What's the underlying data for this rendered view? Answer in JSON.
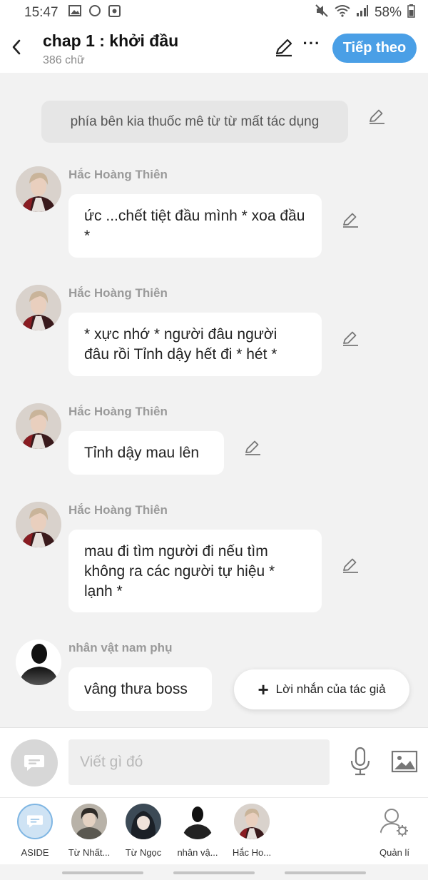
{
  "status_bar": {
    "time": "15:47",
    "battery": "58%"
  },
  "header": {
    "title": "chap 1 : khởi đầu",
    "subtitle": "386 chữ",
    "next_label": "Tiếp theo",
    "more": "···"
  },
  "narration": "phía bên kia thuốc mê từ từ mất tác dụng",
  "messages": [
    {
      "name": "Hắc Hoàng Thiên",
      "text": "ức ...chết tiệt đầu mình * xoa đầu *"
    },
    {
      "name": "Hắc Hoàng Thiên",
      "text": "* xực nhớ * người đâu người đâu rồi Tỉnh dậy hết đi * hét *"
    },
    {
      "name": "Hắc Hoàng Thiên",
      "text": "Tỉnh dậy mau lên"
    },
    {
      "name": "Hắc Hoàng Thiên",
      "text": "mau đi tìm người đi nếu tìm không ra các người tự hiệu * lạnh *"
    },
    {
      "name": "nhân vật nam phụ",
      "text": "vâng thưa boss"
    }
  ],
  "author_note": {
    "plus": "+",
    "label": "Lời nhắn của tác giả"
  },
  "composer": {
    "placeholder": "Viết gì đó"
  },
  "characters": [
    {
      "label": "ASIDE"
    },
    {
      "label": "Từ Nhất..."
    },
    {
      "label": "Từ Ngọc"
    },
    {
      "label": "nhân vậ..."
    },
    {
      "label": "Hắc Ho..."
    },
    {
      "label": "Quản lí"
    }
  ],
  "colors": {
    "accent": "#4a9fe6",
    "bubble": "#ffffff",
    "background": "#f2f2f2",
    "narration_bg": "#e6e6e6"
  },
  "icons": [
    "back-arrow-icon",
    "pencil-icon",
    "more-icon",
    "mic-icon",
    "image-icon",
    "chat-bubble-icon",
    "user-settings-icon"
  ]
}
